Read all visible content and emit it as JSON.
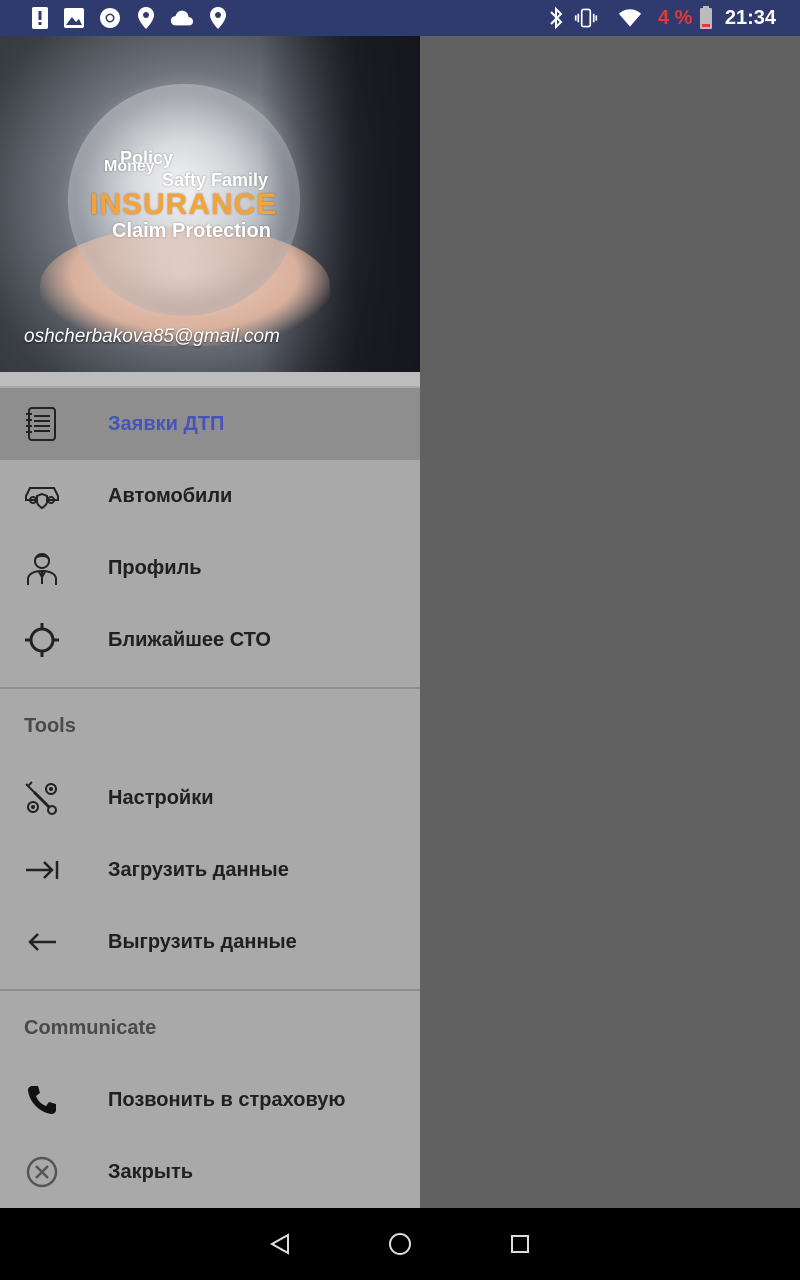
{
  "status_bar": {
    "time": "21:34",
    "battery_percent": "4 %",
    "left_icons": [
      "alert-icon",
      "image-icon",
      "chrome-icon",
      "location-icon",
      "cloud-icon",
      "location-icon"
    ],
    "right_icons": [
      "bluetooth-icon",
      "vibrate-icon",
      "wifi-icon",
      "battery-icon"
    ],
    "battery_color": "#e53935"
  },
  "drawer": {
    "header": {
      "email": "oshcherbakova85@gmail.com",
      "image_words": [
        "INSURANCE",
        "Claim Protection",
        "Policy",
        "Safty Family",
        "Money"
      ]
    },
    "items": [
      {
        "label": "Заявки ДТП",
        "icon": "notepad-icon",
        "active": true
      },
      {
        "label": "Автомобили",
        "icon": "car-shield-icon"
      },
      {
        "label": "Профиль",
        "icon": "person-icon"
      },
      {
        "label": "Ближайшее СТО",
        "icon": "target-icon"
      }
    ],
    "tools_section": {
      "title": "Tools",
      "items": [
        {
          "label": "Настройки",
          "icon": "wrench-gear-icon"
        },
        {
          "label": "Загрузить данные",
          "icon": "arrow-right-bar-icon"
        },
        {
          "label": "Выгрузить данные",
          "icon": "arrow-left-icon"
        }
      ]
    },
    "communicate_section": {
      "title": "Communicate",
      "items": [
        {
          "label": "Позвонить в страховую",
          "icon": "phone-icon"
        },
        {
          "label": "Закрыть",
          "icon": "close-circle-icon"
        }
      ]
    },
    "active_color": "#4554b8"
  },
  "nav_bar": {
    "buttons": [
      "back-icon",
      "home-icon",
      "recents-icon"
    ]
  }
}
